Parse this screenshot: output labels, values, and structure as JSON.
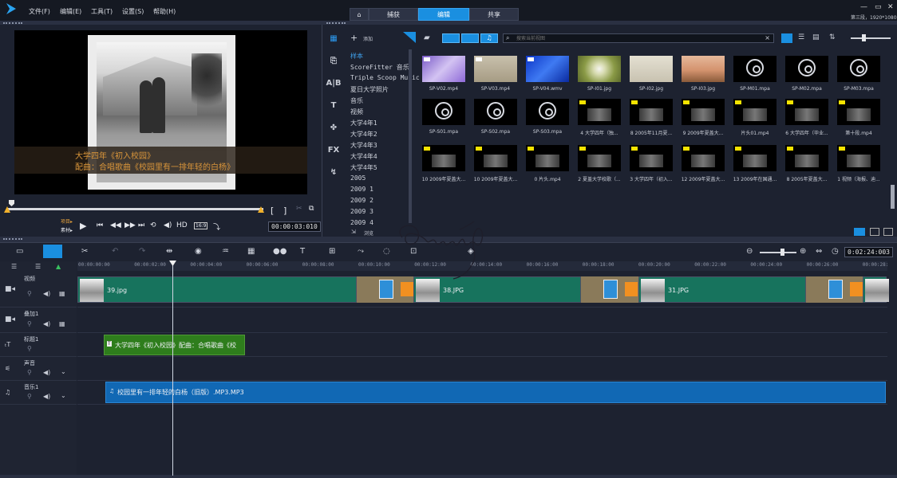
{
  "menu": [
    "文件(F)",
    "编辑(E)",
    "工具(T)",
    "设置(S)",
    "帮助(H)"
  ],
  "modes": {
    "home": "⌂",
    "capture": "捕获",
    "edit": "编辑",
    "share": "共享"
  },
  "window": {
    "min": "—",
    "max": "▭",
    "close": "✕",
    "project_info": "第三段，1920*1080"
  },
  "preview": {
    "subtitle_line1": "大学四年《初入校园》",
    "subtitle_line2": "配曲：合唱歌曲《校园里有一排年轻的白杨》",
    "project_label": "项目▸",
    "clip_label": "素材▸",
    "hd": "HD",
    "aspect": "16:9",
    "timecode": "00:00:03:010",
    "mark_in": "[",
    "mark_out": "]"
  },
  "library": {
    "add_label": "添加",
    "search_placeholder": "搜索当前视图",
    "browse_label": "浏览",
    "folders": [
      "样本",
      "ScoreFitter 音乐",
      "Triple Scoop Music",
      "夏日大学照片",
      "音乐",
      "视频",
      "大学4年1",
      "大学4年2",
      "大学4年3",
      "大学4年4",
      "大学4年5",
      "2005",
      "2009 1",
      "2009 2",
      "2009 3",
      "2009 4"
    ],
    "selected_folder": "样本",
    "thumbnails": [
      {
        "label": "SP-V02.mp4",
        "kind": "purple"
      },
      {
        "label": "SP-V03.mp4",
        "kind": "beige"
      },
      {
        "label": "SP-V04.wmv",
        "kind": "blue"
      },
      {
        "label": "SP-I01.jpg",
        "kind": "dandelion"
      },
      {
        "label": "SP-I02.jpg",
        "kind": "paper"
      },
      {
        "label": "SP-I03.jpg",
        "kind": "sunset"
      },
      {
        "label": "SP-M01.mpa",
        "kind": "music"
      },
      {
        "label": "SP-M02.mpa",
        "kind": "music"
      },
      {
        "label": "SP-M03.mpa",
        "kind": "music"
      },
      {
        "label": "SP-S01.mpa",
        "kind": "music"
      },
      {
        "label": "SP-S02.mpa",
        "kind": "music"
      },
      {
        "label": "SP-S03.mpa",
        "kind": "music"
      },
      {
        "label": "4 大学四年（独...",
        "kind": "video"
      },
      {
        "label": "8 2005年11月夏...",
        "kind": "video"
      },
      {
        "label": "9 2009年夏盖大...",
        "kind": "video"
      },
      {
        "label": "片头01.mp4",
        "kind": "video"
      },
      {
        "label": "6 大学四年（毕业...",
        "kind": "video"
      },
      {
        "label": "第十段.mp4",
        "kind": "video"
      },
      {
        "label": "10 2009年夏盖大...",
        "kind": "video"
      },
      {
        "label": "10 2009年夏盖大...",
        "kind": "video"
      },
      {
        "label": "0 片头.mp4",
        "kind": "video"
      },
      {
        "label": "2 夏盖大学校歌（...",
        "kind": "video"
      },
      {
        "label": "3 大学四年（初入...",
        "kind": "video"
      },
      {
        "label": "12 2009年夏盖大...",
        "kind": "video"
      },
      {
        "label": "13 2009年在国通...",
        "kind": "video"
      },
      {
        "label": "8 2005年夏盖大...",
        "kind": "video"
      },
      {
        "label": "1 视频（海报、迪...",
        "kind": "video"
      }
    ]
  },
  "timeline": {
    "timecode": "0:02:24:003",
    "ruler": [
      "00:00:00:00",
      "00:00:02:00",
      "00:00:04:00",
      "00:00:06:00",
      "00:00:08:00",
      "00:00:10:00",
      "00:00:12:00",
      "00:00:14:00",
      "00:00:16:00",
      "00:00:18:00",
      "00:00:20:00",
      "00:00:22:00",
      "00:00:24:00",
      "00:00:26:00",
      "00:00:28:00"
    ],
    "tracks": {
      "video": "视频",
      "overlay": "叠加1",
      "title": "标题1",
      "voice": "声音",
      "music": "音乐1"
    },
    "clips": {
      "video1": "39.jpg",
      "video2": "38.JPG",
      "video3": "31.JPG",
      "title": "大学四年《初入校园》配曲：合唱歌曲《校",
      "music": "校园里有一排年轻的白杨（旧版）.MP3.MP3"
    }
  },
  "colors": {
    "accent": "#1a8fe0",
    "video_clip": "#17735d",
    "title_clip": "#2e7d1c",
    "music_clip": "#1168b4",
    "subtitle": "#d9953a"
  }
}
